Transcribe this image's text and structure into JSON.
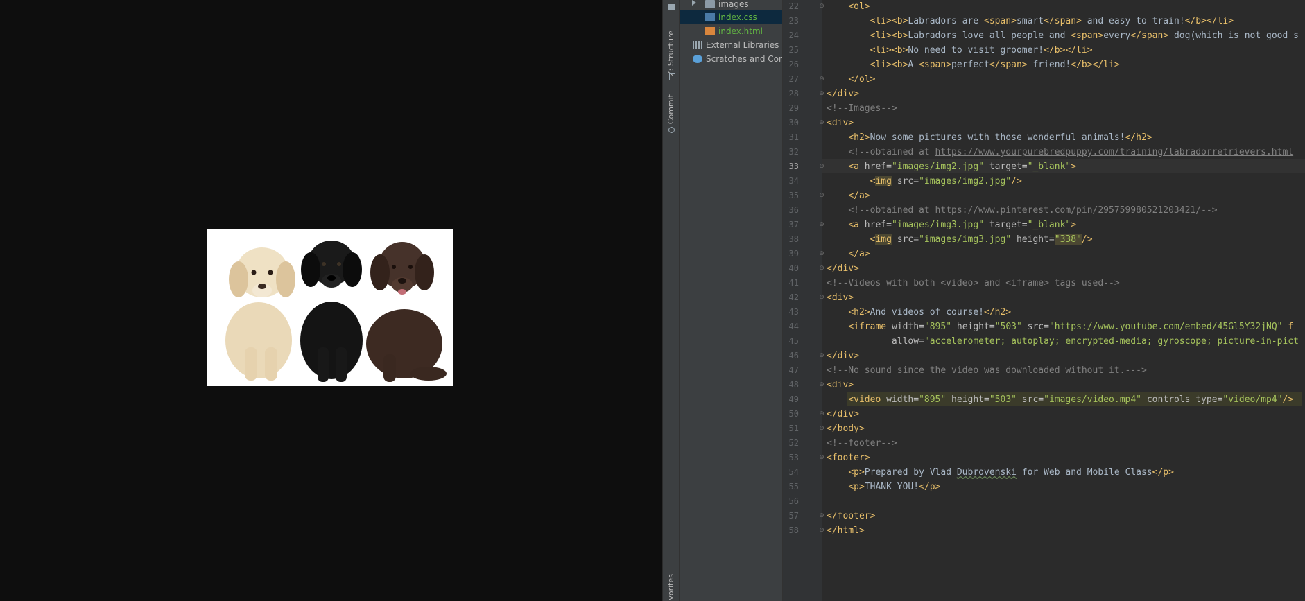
{
  "viewer": {
    "image_alt": "Three labrador puppies (yellow, black, chocolate)"
  },
  "toolstrip": {
    "tabs": [
      {
        "label": "Z: Structure"
      },
      {
        "label": "Commit"
      },
      {
        "label": "vorites"
      }
    ]
  },
  "project_tree": {
    "rows": [
      {
        "label": "images",
        "kind": "folder"
      },
      {
        "label": "index.css",
        "kind": "css"
      },
      {
        "label": "index.html",
        "kind": "html"
      },
      {
        "label": "External Libraries",
        "kind": "lib"
      },
      {
        "label": "Scratches and Conso",
        "kind": "scratch"
      }
    ]
  },
  "editor": {
    "current_line": "33",
    "line_numbers": [
      "22",
      "23",
      "24",
      "25",
      "26",
      "27",
      "28",
      "29",
      "30",
      "31",
      "32",
      "33",
      "34",
      "35",
      "36",
      "37",
      "38",
      "39",
      "40",
      "41",
      "42",
      "43",
      "44",
      "45",
      "46",
      "47",
      "48",
      "49",
      "50",
      "51",
      "52",
      "53",
      "54",
      "55",
      "56",
      "57",
      "58"
    ],
    "lines": {
      "l22": [
        "    ",
        "<ol>"
      ],
      "l23": [
        "        ",
        "<li><b>",
        "Labradors are ",
        "<span>",
        "smart",
        "</span>",
        " and easy to train!",
        "</b></li>"
      ],
      "l24": [
        "        ",
        "<li><b>",
        "Labradors love all people and ",
        "<span>",
        "every",
        "</span>",
        " dog(which is not good s"
      ],
      "l25": [
        "        ",
        "<li><b>",
        "No need to visit groomer!",
        "</b></li>"
      ],
      "l26": [
        "        ",
        "<li><b>",
        "A ",
        "<span>",
        "perfect",
        "</span>",
        " friend!",
        "</b></li>"
      ],
      "l27": [
        "    ",
        "</ol>"
      ],
      "l28": [
        "",
        "</div>"
      ],
      "l29": [
        "",
        "<!--Images-->"
      ],
      "l30": [
        "",
        "<div>"
      ],
      "l31": [
        "    ",
        "<h2>",
        "Now some pictures with those wonderful animals!",
        "</h2>"
      ],
      "l32": [
        "    ",
        "<!--obtained at ",
        "https://www.yourpurebredpuppy.com/training/labradorretrievers.html"
      ],
      "l33": [
        "    ",
        "<a ",
        "href=",
        "\"images/img2.jpg\"",
        " target=",
        "\"_blank\"",
        ">"
      ],
      "l34": [
        "        ",
        "<",
        "img",
        " src=",
        "\"images/img2.jpg\"",
        "/>"
      ],
      "l35": [
        "    ",
        "</a>"
      ],
      "l36": [
        "    ",
        "<!--obtained at ",
        "https://www.pinterest.com/pin/295759980521203421/",
        "-->"
      ],
      "l37": [
        "    ",
        "<a ",
        "href=",
        "\"images/img3.jpg\"",
        " target=",
        "\"_blank\"",
        ">"
      ],
      "l38": [
        "        ",
        "<",
        "img",
        " src=",
        "\"images/img3.jpg\"",
        " height=",
        "\"338\"",
        "/>"
      ],
      "l39": [
        "    ",
        "</a>"
      ],
      "l40": [
        "",
        "</div>"
      ],
      "l41": [
        "",
        "<!--Videos with both <video> and <iframe> tags used-->"
      ],
      "l42": [
        "",
        "<div>"
      ],
      "l43": [
        "    ",
        "<h2>",
        "And videos of course!",
        "</h2>"
      ],
      "l44": [
        "    ",
        "<iframe ",
        "width=",
        "\"895\"",
        " height=",
        "\"503\"",
        " src=",
        "\"https://www.youtube.com/embed/45Gl5Y32jNQ\"",
        " f"
      ],
      "l45": [
        "            ",
        "allow=",
        "\"accelerometer; autoplay; encrypted-media; gyroscope; picture-in-pict"
      ],
      "l46": [
        "",
        "</div>"
      ],
      "l47": [
        "",
        "<!--No sound since the video was downloaded without it.--->"
      ],
      "l48": [
        "",
        "<div>"
      ],
      "l49": [
        "    ",
        "<video ",
        "width=",
        "\"895\"",
        " height=",
        "\"503\"",
        " src=",
        "\"images/video.mp4\"",
        " controls type=",
        "\"video/mp4\"",
        "/>"
      ],
      "l50": [
        "",
        "</div>"
      ],
      "l51": [
        "",
        "</body>"
      ],
      "l52": [
        "",
        "<!--footer-->"
      ],
      "l53": [
        "",
        "<footer>"
      ],
      "l54": [
        "    ",
        "<p>",
        "Prepared by Vlad ",
        "Dubrovenski",
        " for Web and Mobile Class",
        "</p>"
      ],
      "l55": [
        "    ",
        "<p>",
        "THANK YOU!",
        "</p>"
      ],
      "l56": [
        ""
      ],
      "l57": [
        "",
        "</footer>"
      ],
      "l58": [
        "",
        "</html>"
      ]
    }
  }
}
